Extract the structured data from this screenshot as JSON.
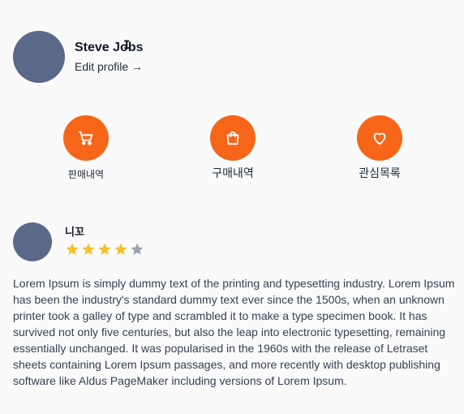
{
  "profile": {
    "name": "Steve Jobs",
    "edit_label": "Edit profile →"
  },
  "actions": [
    {
      "label": "판매내역",
      "icon": "shopping-cart-icon"
    },
    {
      "label": "구매내역",
      "icon": "shopping-bag-icon"
    },
    {
      "label": "관심목록",
      "icon": "heart-icon"
    }
  ],
  "review": {
    "reviewer": "니꼬",
    "rating": 4,
    "max_rating": 5,
    "body": "Lorem Ipsum is simply dummy text of the printing and typesetting industry. Lorem Ipsum has been the industry's standard dummy text ever since the 1500s, when an unknown printer took a galley of type and scrambled it to make a type specimen book. It has survived not only five centuries, but also the leap into electronic typesetting, remaining essentially unchanged. It was popularised in the 1960s with the release of Letraset sheets containing Lorem Ipsum passages, and more recently with desktop publishing software like Aldus PageMaker including versions of Lorem Ipsum."
  },
  "colors": {
    "accent": "#f76618",
    "avatar": "#5a6987",
    "star_filled": "#fbbf24",
    "star_empty": "#9ca3af"
  }
}
